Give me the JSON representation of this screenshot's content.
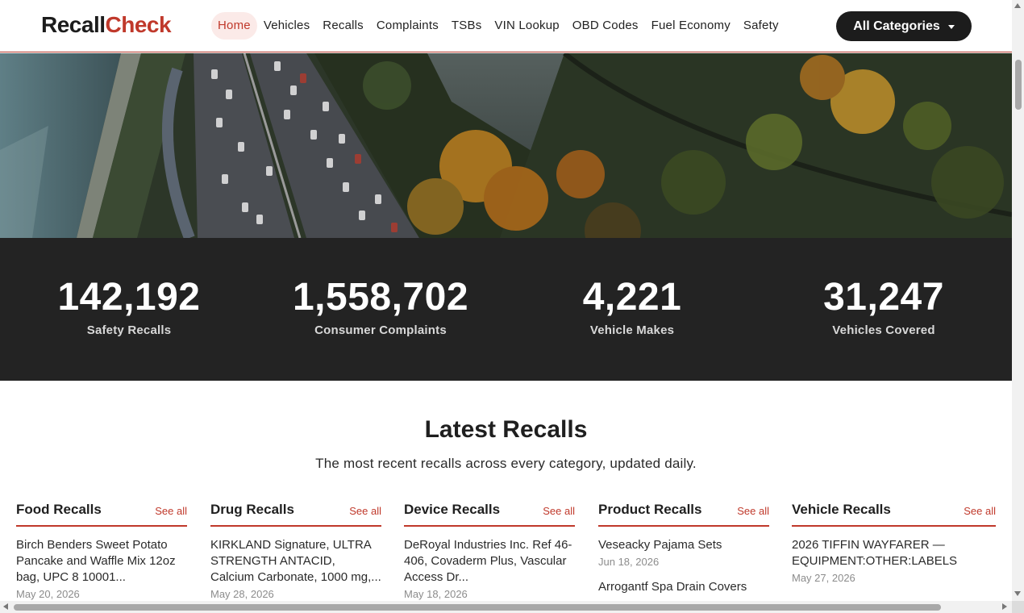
{
  "header": {
    "logo_part1": "Recall",
    "logo_part2": "Check",
    "nav": [
      {
        "label": "Home",
        "active": true
      },
      {
        "label": "Vehicles"
      },
      {
        "label": "Recalls"
      },
      {
        "label": "Complaints"
      },
      {
        "label": "TSBs"
      },
      {
        "label": "VIN Lookup"
      },
      {
        "label": "OBD Codes"
      },
      {
        "label": "Fuel Economy"
      },
      {
        "label": "Safety"
      }
    ],
    "categories_button": "All Categories"
  },
  "stats": [
    {
      "value": "142,192",
      "label": "Safety Recalls"
    },
    {
      "value": "1,558,702",
      "label": "Consumer Complaints"
    },
    {
      "value": "4,221",
      "label": "Vehicle Makes"
    },
    {
      "value": "31,247",
      "label": "Vehicles Covered"
    }
  ],
  "latest": {
    "title": "Latest Recalls",
    "subtitle": "The most recent recalls across every category, updated daily.",
    "columns": [
      {
        "title": "Food Recalls",
        "see_all": "See all",
        "items": [
          {
            "title": "Birch Benders Sweet Potato Pancake and Waffle Mix 12oz bag, UPC 8 10001...",
            "date": "May 20, 2026"
          }
        ]
      },
      {
        "title": "Drug Recalls",
        "see_all": "See all",
        "items": [
          {
            "title": "KIRKLAND Signature, ULTRA STRENGTH ANTACID, Calcium Carbonate, 1000 mg,...",
            "date": "May 28, 2026"
          }
        ]
      },
      {
        "title": "Device Recalls",
        "see_all": "See all",
        "items": [
          {
            "title": "DeRoyal Industries Inc. Ref 46-406, Covaderm Plus, Vascular Access Dr...",
            "date": "May 18, 2026"
          }
        ]
      },
      {
        "title": "Product Recalls",
        "see_all": "See all",
        "items": [
          {
            "title": "Veseacky Pajama Sets",
            "date": "Jun 18, 2026"
          },
          {
            "title": "Arrogantf Spa Drain Covers",
            "date": ""
          }
        ]
      },
      {
        "title": "Vehicle Recalls",
        "see_all": "See all",
        "items": [
          {
            "title": "2026 TIFFIN WAYFARER — EQUIPMENT:OTHER:LABELS",
            "date": "May 27, 2026"
          }
        ]
      }
    ]
  },
  "colors": {
    "brand": "#c0392b",
    "dark": "#1c1c1c",
    "stats_bg": "#232323"
  }
}
